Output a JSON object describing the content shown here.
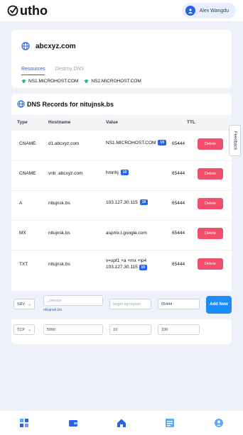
{
  "app": {
    "logo_text": "utho",
    "user_name": "Alex Wangdu"
  },
  "domain": {
    "name": "abcxyz.com",
    "tabs": [
      {
        "label": "Resources",
        "active": true
      },
      {
        "label": "Destroy DNS",
        "active": false
      }
    ],
    "nameservers": [
      "NS1.MICROHOST.COM",
      "NS2.MICROHOST.COM"
    ]
  },
  "dns": {
    "title": "DNS Records for nitujnsk.bs",
    "headers": {
      "type": "Type",
      "hostname": "Hostname",
      "value": "Value",
      "ttl": "TTL"
    },
    "delete_label": "Delete",
    "records": [
      {
        "type": "CNAME",
        "hostname": "d1.abcxyz.com",
        "value": "NS1.MICROHOST.COM",
        "badge": "10",
        "ttl": "65444"
      },
      {
        "type": "CNAME",
        "hostname": "vnb .abcxyz.com",
        "value": "hmnhj",
        "badge": "10",
        "ttl": "65444"
      },
      {
        "type": "A",
        "hostname": "nitujnsk.bs",
        "value": "103.127.30.115",
        "badge": "10",
        "ttl": "65444"
      },
      {
        "type": "MX",
        "hostname": "nitujnsk.bs",
        "value": "aspmx.l.google.com",
        "badge": "",
        "ttl": "65444"
      },
      {
        "type": "TXT",
        "hostname": "nitujnsk.bs",
        "value": "v=spf1 +a +mx +ip4 103.127.30.115",
        "badge": "10",
        "ttl": "65444"
      }
    ],
    "new_srv": {
      "type_select": "SRV",
      "service_placeholder": "_service",
      "service_hint": "nitujnsk.bs",
      "target_placeholder": "target eg:mysen",
      "ttl": "65444",
      "add_label": "Add New"
    },
    "new_tcp": {
      "proto_select": "TCP",
      "port": "5060",
      "priority": "10",
      "weight": "100"
    }
  },
  "feedback_label": "Feedback",
  "bottom_nav": [
    "dashboard-icon",
    "wallet-icon",
    "home-icon",
    "list-icon",
    "profile-icon"
  ]
}
